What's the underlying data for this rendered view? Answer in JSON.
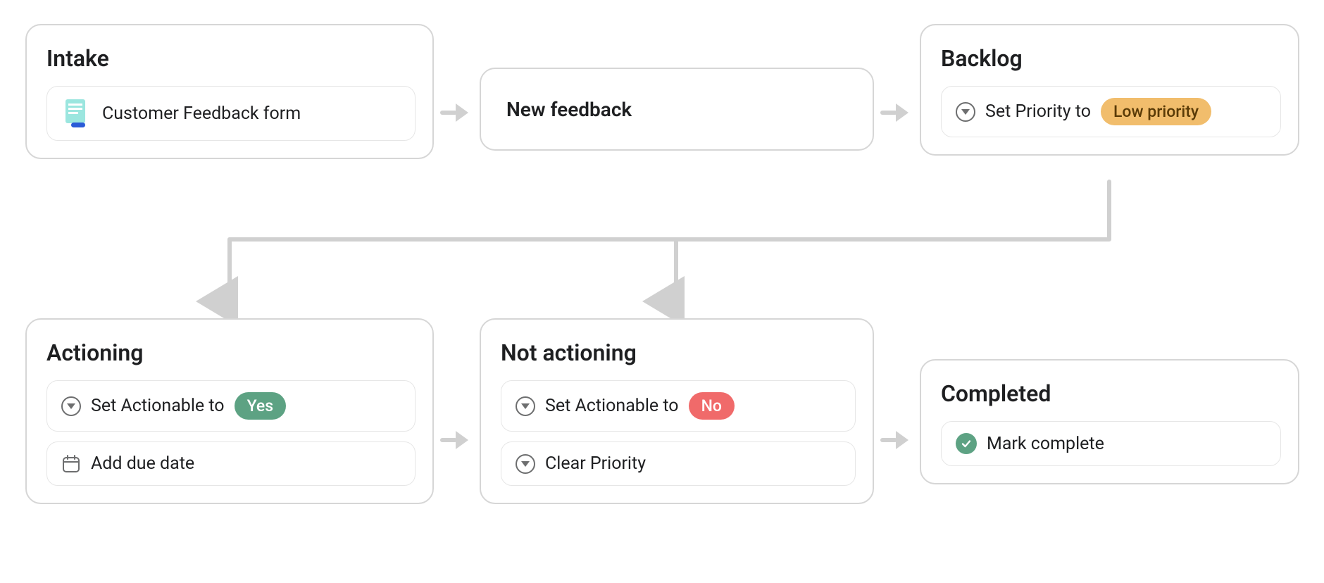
{
  "stages": {
    "intake": {
      "title": "Intake",
      "form_label": "Customer Feedback form"
    },
    "new_feedback": {
      "title": "New feedback"
    },
    "backlog": {
      "title": "Backlog",
      "set_priority_label": "Set Priority to",
      "priority_value": "Low priority"
    },
    "actioning": {
      "title": "Actioning",
      "set_actionable_label": "Set Actionable to",
      "actionable_value": "Yes",
      "add_due_date_label": "Add due date"
    },
    "not_actioning": {
      "title": "Not actioning",
      "set_actionable_label": "Set Actionable to",
      "actionable_value": "No",
      "clear_priority_label": "Clear Priority"
    },
    "completed": {
      "title": "Completed",
      "mark_complete_label": "Mark complete"
    }
  }
}
